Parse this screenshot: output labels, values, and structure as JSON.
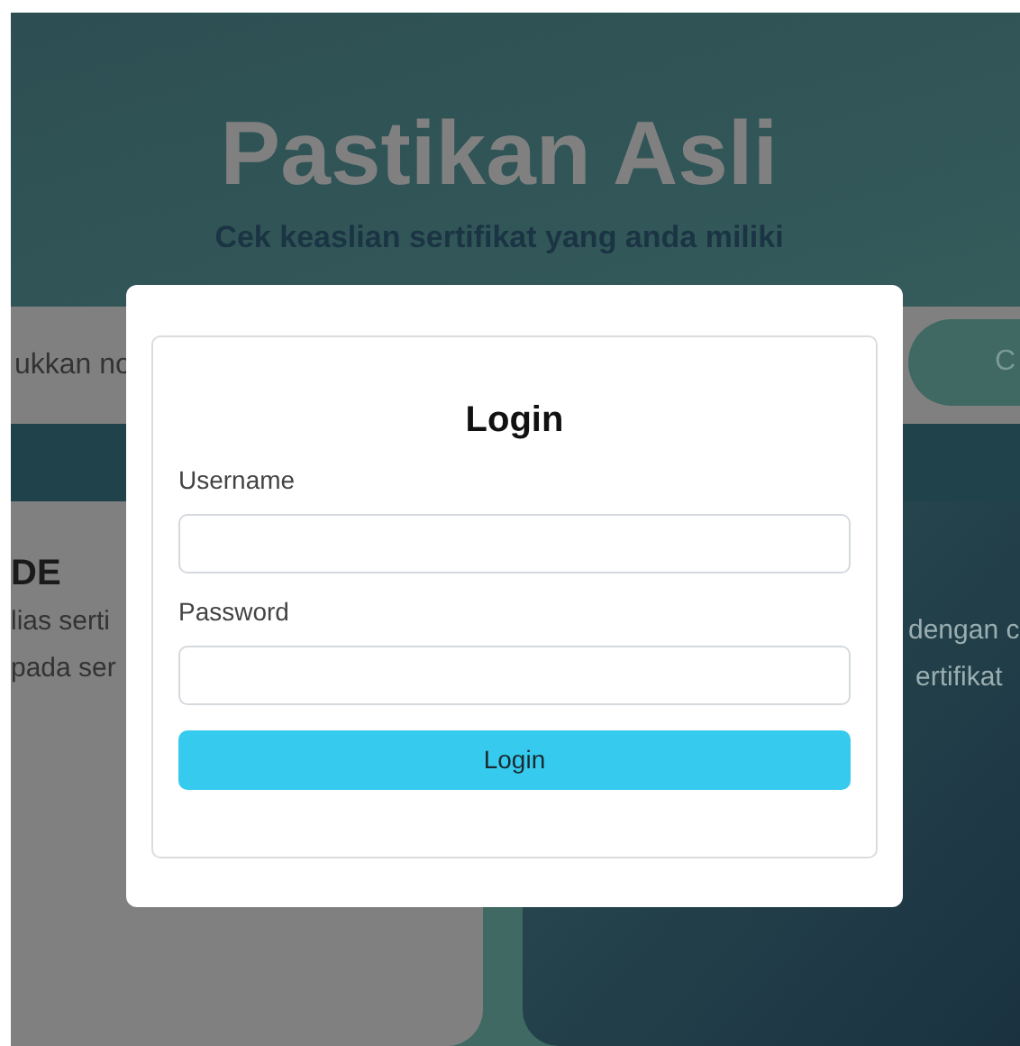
{
  "hero": {
    "title": "Pastikan Asli",
    "subtitle": "Cek keaslian sertifikat yang anda miliki"
  },
  "search": {
    "value": "ukkan no",
    "button": "C"
  },
  "cards": [
    {
      "title": "DE",
      "lines": [
        "lias serti",
        "pada ser"
      ]
    },
    {
      "lines": [
        "dengan c",
        "ertifikat"
      ]
    }
  ],
  "modal": {
    "title": "Login",
    "fields": [
      {
        "label": "Username"
      },
      {
        "label": "Password"
      }
    ],
    "button": "Login"
  }
}
